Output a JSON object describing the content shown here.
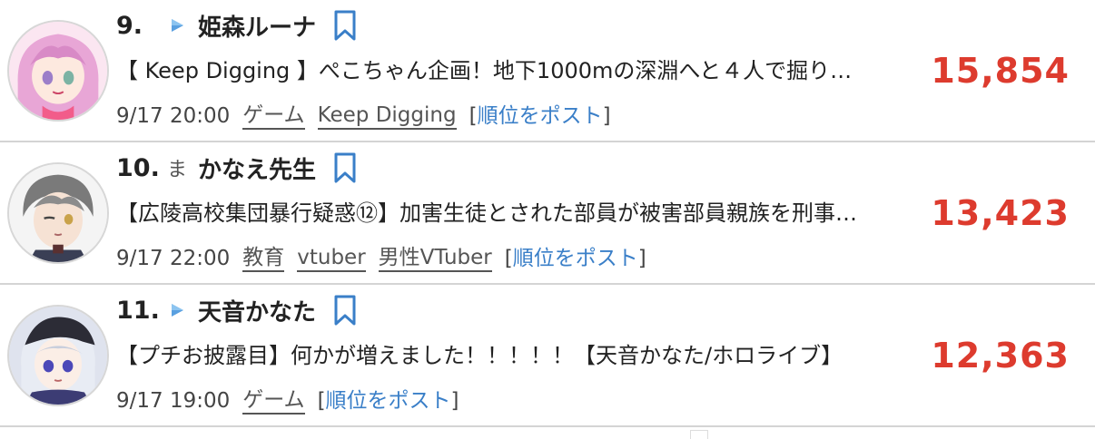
{
  "ranking": [
    {
      "rank": "9.",
      "platform_icon": "youtube-play-icon",
      "channel": "姫森ルーナ",
      "title": "【 Keep Digging 】ぺこちゃん企画！地下1000mの深淵へと４人で掘り…",
      "date": "9/17 20:00",
      "tags": [
        "ゲーム",
        "Keep Digging"
      ],
      "post_open": "[",
      "post_label": "順位をポスト",
      "post_close": "]",
      "count": "15,854"
    },
    {
      "rank": "10.",
      "platform_icon": "ま",
      "channel": "かなえ先生",
      "title": "【広陵高校集団暴行疑惑⑫】加害生徒とされた部員が被害部員親族を刑事…",
      "date": "9/17 22:00",
      "tags": [
        "教育",
        "vtuber",
        "男性VTuber"
      ],
      "post_open": "[",
      "post_label": "順位をポスト",
      "post_close": "]",
      "count": "13,423"
    },
    {
      "rank": "11.",
      "platform_icon": "youtube-play-icon",
      "channel": "天音かなた",
      "title": "【プチお披露目】何かが増えました！！！！！【天音かなた/ホロライブ】",
      "date": "9/17 19:00",
      "tags": [
        "ゲーム"
      ],
      "post_open": "[",
      "post_label": "順位をポスト",
      "post_close": "]",
      "count": "12,363"
    }
  ],
  "colors": {
    "count": "#dd3b2e",
    "link": "#3a7fc8",
    "divider": "#d4d4d4",
    "platform": "#5aa0e0"
  }
}
